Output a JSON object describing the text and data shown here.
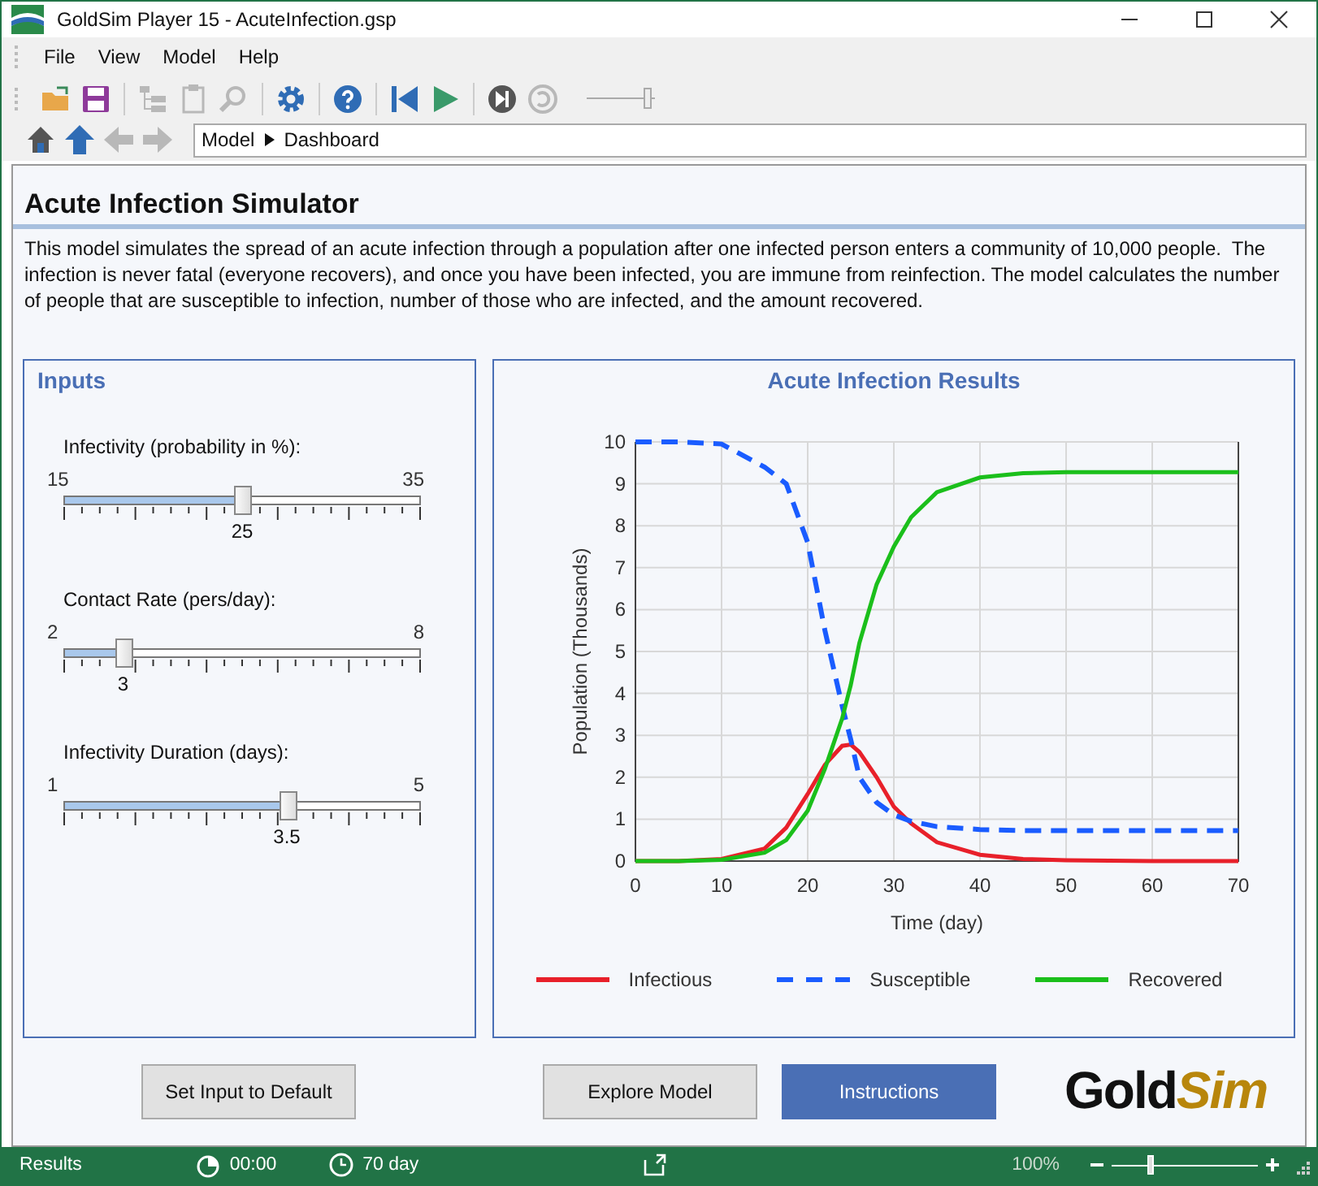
{
  "window": {
    "title": "GoldSim Player 15  - AcuteInfection.gsp"
  },
  "menu": [
    "File",
    "View",
    "Model",
    "Help"
  ],
  "toolbar": [
    {
      "kind": "open",
      "disabled": false
    },
    {
      "kind": "save",
      "disabled": false
    },
    {
      "kind": "sep"
    },
    {
      "kind": "tree",
      "disabled": true
    },
    {
      "kind": "clipboard",
      "disabled": true
    },
    {
      "kind": "find",
      "disabled": true
    },
    {
      "kind": "sep"
    },
    {
      "kind": "settings",
      "disabled": false
    },
    {
      "kind": "sep"
    },
    {
      "kind": "help",
      "disabled": false
    },
    {
      "kind": "sep"
    },
    {
      "kind": "rewind",
      "disabled": false
    },
    {
      "kind": "play",
      "disabled": false
    },
    {
      "kind": "sep"
    },
    {
      "kind": "step",
      "disabled": false
    },
    {
      "kind": "reset",
      "disabled": true
    }
  ],
  "speed_slider": {
    "level": 0.9
  },
  "nav": [
    {
      "kind": "home",
      "disabled": false
    },
    {
      "kind": "up",
      "disabled": false
    },
    {
      "kind": "back",
      "disabled": true
    },
    {
      "kind": "forward",
      "disabled": true
    }
  ],
  "breadcrumb": [
    "Model",
    "Dashboard"
  ],
  "page": {
    "title": "Acute Infection Simulator",
    "description": "This model simulates the spread of an acute infection through a population after one infected person enters a community of 10,000 people.  The infection is never fatal (everyone recovers), and once you have been infected, you are immune from reinfection. The model calculates the number of people that are susceptible to infection, number of those who are infected, and the amount recovered."
  },
  "inputs": {
    "title": "Inputs",
    "sliders": [
      {
        "label": "Infectivity (probability in %):",
        "min": "15",
        "max": "35",
        "value": "25",
        "level": 0.5
      },
      {
        "label": "Contact Rate (pers/day):",
        "min": "2",
        "max": "8",
        "value": "3",
        "level": 0.1667
      },
      {
        "label": "Infectivity Duration (days):",
        "min": "1",
        "max": "5",
        "value": "3.5",
        "level": 0.625
      }
    ]
  },
  "results": {
    "title": "Acute Infection Results",
    "chart_data": {
      "type": "line",
      "xlabel": "Time (day)",
      "ylabel": "Population (Thousands)",
      "xlim": [
        0,
        70
      ],
      "ylim": [
        0,
        10
      ],
      "xticks": [
        0,
        10,
        20,
        30,
        40,
        50,
        60,
        70
      ],
      "yticks": [
        0,
        1,
        2,
        3,
        4,
        5,
        6,
        7,
        8,
        9,
        10
      ],
      "grid": true,
      "legend": "bottom",
      "x": [
        0,
        5,
        10,
        15,
        17.5,
        20,
        22,
        24,
        25,
        26,
        28,
        30,
        32,
        35,
        40,
        45,
        50,
        60,
        70
      ],
      "series": [
        {
          "name": "Infectious",
          "color": "#e8202a",
          "line_style": "solid",
          "values": [
            0,
            0,
            0.05,
            0.3,
            0.8,
            1.6,
            2.3,
            2.75,
            2.78,
            2.6,
            2.0,
            1.3,
            0.9,
            0.45,
            0.15,
            0.05,
            0.02,
            0,
            0
          ]
        },
        {
          "name": "Susceptible",
          "color": "#1a5cff",
          "line_style": "dashed",
          "values": [
            10,
            10,
            9.95,
            9.4,
            9.0,
            7.6,
            5.5,
            3.7,
            2.9,
            2.0,
            1.4,
            1.1,
            0.95,
            0.82,
            0.75,
            0.73,
            0.73,
            0.73,
            0.73
          ]
        },
        {
          "name": "Recovered",
          "color": "#1bbf1b",
          "line_style": "solid",
          "values": [
            0,
            0,
            0.03,
            0.2,
            0.5,
            1.2,
            2.2,
            3.4,
            4.2,
            5.2,
            6.6,
            7.5,
            8.2,
            8.8,
            9.15,
            9.25,
            9.28,
            9.28,
            9.28
          ]
        }
      ]
    }
  },
  "buttons": [
    {
      "label": "Set Input to Default",
      "primary": false
    },
    {
      "label": "Explore Model",
      "primary": false
    },
    {
      "label": "Instructions",
      "primary": true
    }
  ],
  "logo": {
    "text": "Gold",
    "accent": "Sim"
  },
  "status_bar": {
    "mode": "Results",
    "elapsed": "00:00",
    "duration": "70 day",
    "zoom": "100%",
    "zoom_level": {
      "level": 0.27
    }
  }
}
